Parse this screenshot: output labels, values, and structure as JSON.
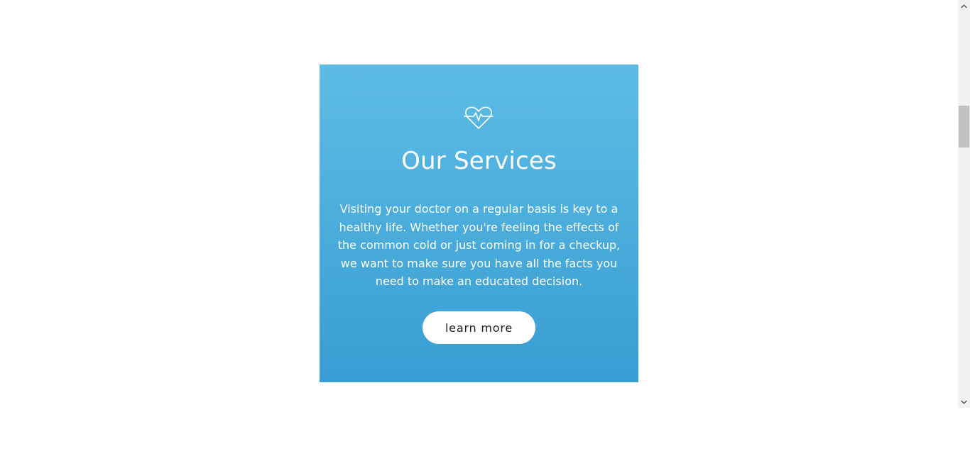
{
  "services": {
    "title": "Our Services",
    "description": "Visiting your doctor on a regular basis is key to a healthy life. Whether you're feeling the effects of the common cold or just coming in for a checkup, we want to make sure you have all the facts you need to make an educated decision.",
    "button_label": "learn more",
    "icon": "heart-pulse-icon"
  },
  "colors": {
    "gradient_top": "#5dbde5",
    "gradient_bottom": "#389dd3",
    "text": "#ffffff",
    "button_bg": "#ffffff",
    "button_text": "#1b1b1b"
  }
}
